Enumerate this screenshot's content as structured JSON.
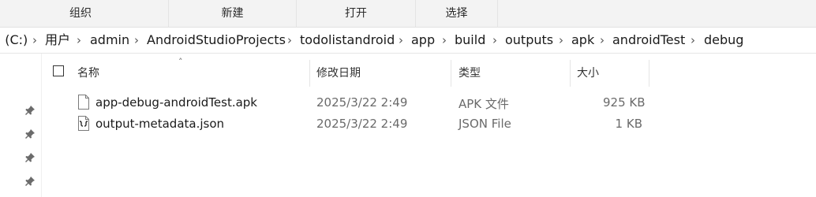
{
  "ribbon": {
    "tabs": [
      {
        "label": "组织"
      },
      {
        "label": "新建"
      },
      {
        "label": "打开"
      },
      {
        "label": "选择"
      }
    ]
  },
  "address": {
    "crumbs": [
      "∶ (C:)",
      "用户",
      "admin",
      "AndroidStudioProjects",
      "todolistandroid",
      "app",
      "build",
      "outputs",
      "apk",
      "androidTest",
      "debug"
    ]
  },
  "columns": {
    "name": "名称",
    "modified": "修改日期",
    "type": "类型",
    "size": "大小"
  },
  "files": [
    {
      "name": "app-debug-androidTest.apk",
      "modified": "2025/3/22 2:49",
      "type": "APK 文件",
      "size": "925 KB",
      "icon": "blank-file-icon"
    },
    {
      "name": "output-metadata.json",
      "modified": "2025/3/22 2:49",
      "type": "JSON File",
      "size": "1 KB",
      "icon": "json-file-icon"
    }
  ],
  "nav": {
    "pins": [
      "pin-icon",
      "pin-icon",
      "pin-icon",
      "pin-icon"
    ]
  }
}
